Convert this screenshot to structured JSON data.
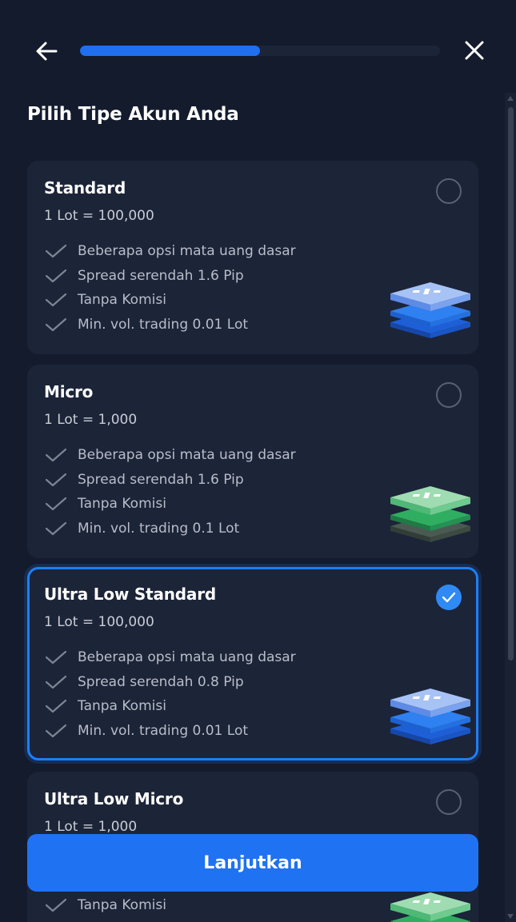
{
  "header": {
    "back_icon": "arrow-left-icon",
    "close_icon": "close-icon",
    "progress_fraction": 0.5,
    "progress_color": "#1f6ff0"
  },
  "page_title": "Pilih Tipe Akun Anda",
  "accounts": [
    {
      "name": "Standard",
      "lot": "1 Lot = 100,000",
      "features": [
        "Beberapa opsi mata uang dasar",
        "Spread serendah 1.6 Pip",
        "Tanpa Komisi",
        "Min. vol. trading 0.01 Lot"
      ],
      "selected": false,
      "icon": "blue-stack-icon"
    },
    {
      "name": "Micro",
      "lot": "1 Lot = 1,000",
      "features": [
        "Beberapa opsi mata uang dasar",
        "Spread serendah 1.6 Pip",
        "Tanpa Komisi",
        "Min. vol. trading 0.1 Lot"
      ],
      "selected": false,
      "icon": "green-stack-icon"
    },
    {
      "name": "Ultra Low Standard",
      "lot": "1 Lot = 100,000",
      "features": [
        "Beberapa opsi mata uang dasar",
        "Spread serendah 0.8 Pip",
        "Tanpa Komisi",
        "Min. vol. trading 0.01 Lot"
      ],
      "selected": true,
      "icon": "blue-stack-icon"
    },
    {
      "name": "Ultra Low Micro",
      "lot": "1 Lot = 1,000",
      "features": [
        "Tanpa Komisi"
      ],
      "selected": false,
      "icon": "green-stack-icon"
    }
  ],
  "continue_label": "Lanjutkan",
  "colors": {
    "background": "#141b2d",
    "card": "#1c2438",
    "accent": "#1f72f2",
    "selected_border": "#1f7ef5"
  }
}
